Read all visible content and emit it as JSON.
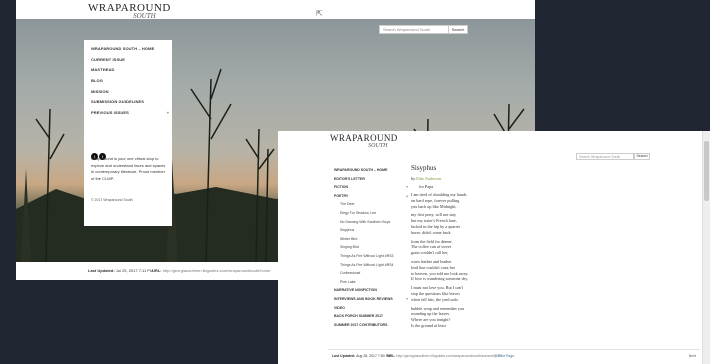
{
  "back_window": {
    "logo": {
      "main": "WRAPAROUND",
      "sub": "SOUTH"
    },
    "search": {
      "placeholder": "Search Wraparound South",
      "button": "Search"
    },
    "nav": [
      {
        "label": "WRAPAROUND SOUTH – HOME",
        "has_chevron": false
      },
      {
        "label": "CURRENT ISSUE",
        "has_chevron": false
      },
      {
        "label": "MASTHEAD",
        "has_chevron": false
      },
      {
        "label": "BLOG",
        "has_chevron": false
      },
      {
        "label": "MISSION",
        "has_chevron": false
      },
      {
        "label": "SUBMISSION GUIDELINES",
        "has_chevron": false
      },
      {
        "label": "PREVIOUS ISSUES",
        "has_chevron": true
      }
    ],
    "social": [
      "twitter-icon",
      "facebook-icon"
    ],
    "about": "Wraparound is your one virtual stop to explore and understand faces and spaces in contemporary literature. Proud member of the CLMP.",
    "copyright": "© 2017 Wraparound South",
    "footer": {
      "updated_label": "Last Updated:",
      "updated_value": "Jul 25, 2017 7:11 PM",
      "url_label": "URL:",
      "url_value": "http://georgiasouthern.libguides.com/wraparoundsouth/home",
      "print": "Print Page"
    }
  },
  "front_window": {
    "logo": {
      "main": "WRAPAROUND",
      "sub": "SOUTH"
    },
    "search": {
      "placeholder": "Search Wraparound South",
      "button": "Search"
    },
    "nav": [
      {
        "label": "WRAPAROUND SOUTH – HOME",
        "level": "top"
      },
      {
        "label": "EDITOR'S LETTER",
        "level": "top"
      },
      {
        "label": "FICTION",
        "level": "top",
        "chevron": true
      },
      {
        "label": "POETRY",
        "level": "top",
        "chevron": true
      },
      {
        "label": "The Deer",
        "level": "sub"
      },
      {
        "label": "Elegy For Shadow, Lee",
        "level": "sub"
      },
      {
        "label": "No Dancing With Southern Boys",
        "level": "sub"
      },
      {
        "label": "Sisyphus",
        "level": "sub"
      },
      {
        "label": "Winter Bird",
        "level": "sub"
      },
      {
        "label": "Singing Bird",
        "level": "sub"
      },
      {
        "label": "Things As Fire Without Light #RS3",
        "level": "sub"
      },
      {
        "label": "Things As Fire Without Light #RS4",
        "level": "sub"
      },
      {
        "label": "Confessional",
        "level": "sub"
      },
      {
        "label": "Pine Lake",
        "level": "sub"
      },
      {
        "label": "NARRATIVE NONFICTION",
        "level": "top"
      },
      {
        "label": "INTERVIEWS AND BOOK REVIEWS",
        "level": "top",
        "chevron": true
      },
      {
        "label": "VIDEO",
        "level": "top"
      },
      {
        "label": "BACK PORCH SUMMER 2017",
        "level": "top"
      },
      {
        "label": "SUMMER 2017 CONTRIBUTORS",
        "level": "top"
      }
    ],
    "poem": {
      "title": "Sisyphus",
      "by": "by",
      "author": "Edie Anderson",
      "dedication": "for Papa",
      "stanzas": [
        "I am tired of shoulding my hands\non hard rope, forever pulling\nyou back up like Midnight,",
        "my first pony, will not stay\nbut my sister's French lane,\nkicked in the hip by a quarter\nhorse, didn't come back",
        "from the field for dinner.\nThe coffee can of sweet\ngrain couldn't call her,",
        "worn leather and leather\nlead line couldn't coax her\nto heaven, you told me look away.\nIf love is wandering someone dry,",
        "I must not love you. But I can't\nstop the questions like leaves\nwhen fall hits, the yard sods",
        "bubble wrap and remember you\nrounding up the leaves.\nWhere are you tonight?\nIs the ground at least"
      ]
    },
    "footer": {
      "updated_label": "Last Updated:",
      "updated_value": "Aug 28, 2017 7:50 PM",
      "url_label": "URL:",
      "url_value": "http://georgiasouthern.libguides.com/wraparoundsouth/summer2017",
      "print": "Print Page",
      "next": "Next"
    }
  }
}
